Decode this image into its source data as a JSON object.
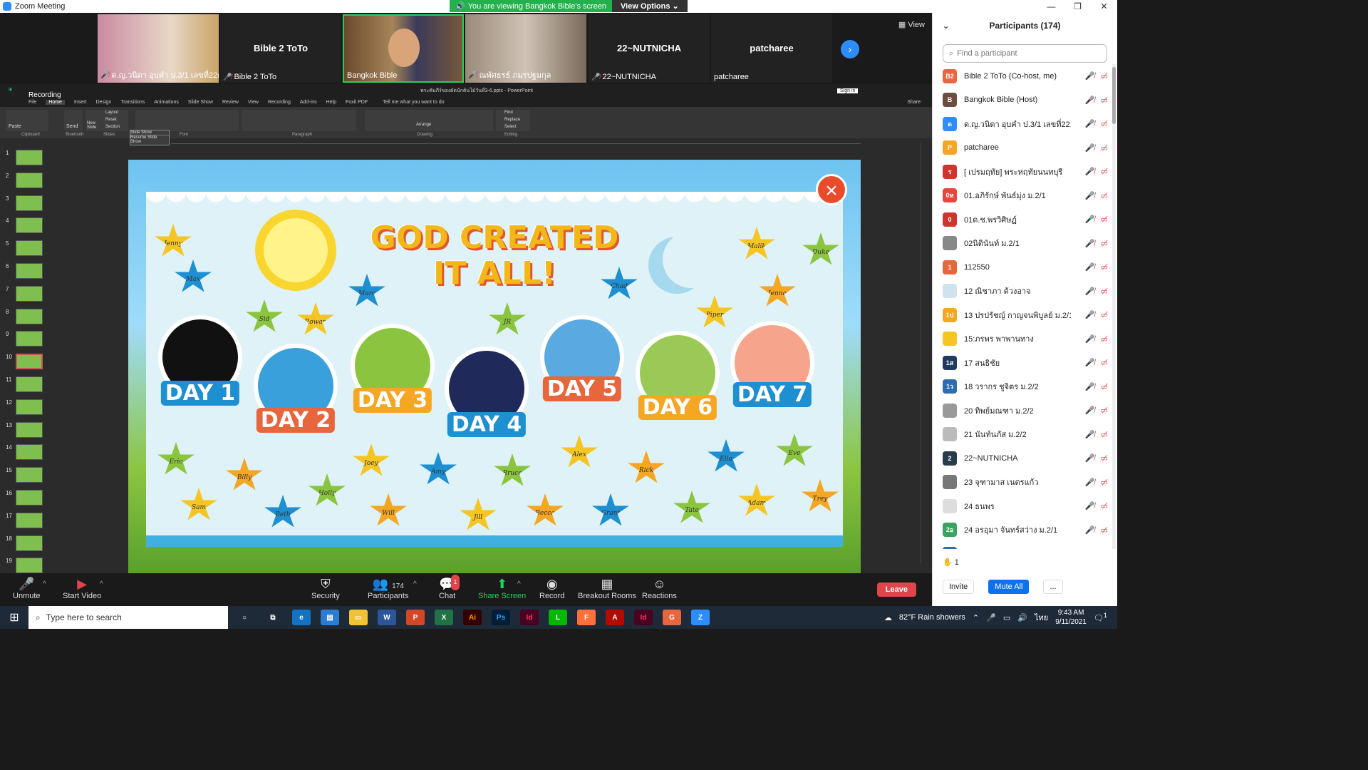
{
  "window": {
    "title": "Zoom Meeting"
  },
  "share_banner": {
    "text": "You are viewing Bangkok Bible's screen",
    "options_label": "View Options"
  },
  "video_strip": {
    "view_label": "View",
    "tiles": [
      {
        "name": "ด.ญ.วนิดา อุบคำ ป.3/1 เลขที่22(w...",
        "big": ""
      },
      {
        "name": "Bible 2 ToTo",
        "big": "Bible 2 ToTo"
      },
      {
        "name": "Bangkok Bible",
        "big": ""
      },
      {
        "name": "ณพัศธรธ์ ภมรปฐมกุล",
        "big": ""
      },
      {
        "name": "22~NUTNICHA",
        "big": "22~NUTNICHA"
      },
      {
        "name": "patcharee",
        "big": "patcharee"
      }
    ]
  },
  "powerpoint": {
    "title": "พระคัมภีร์ของผัดนักต้นไม้วันที่3-6.pptx - PowerPoint",
    "recording_label": "Recording",
    "signin": "Sign in",
    "share": "Share",
    "tell_me": "Tell me what you want to do",
    "tabs": [
      "File",
      "Home",
      "Insert",
      "Design",
      "Transitions",
      "Animations",
      "Slide Show",
      "Review",
      "View",
      "Recording",
      "Add-ins",
      "Help",
      "Foxit PDF"
    ],
    "ribbon_groups": [
      "Clipboard",
      "Bluetooth",
      "Slides",
      "Font",
      "Paragraph",
      "Drawing",
      "Editing"
    ],
    "ribbon_labels": {
      "paste": "Paste",
      "send": "Send",
      "new_slide": "New Slide",
      "layout": "Layout",
      "reset": "Reset",
      "section": "Section",
      "find": "Find",
      "replace": "Replace",
      "select": "Select",
      "arrange": "Arrange"
    },
    "slideshow_popup": {
      "title": "Slide Show",
      "resume": "Resume Slide Show"
    },
    "thumbnail_numbers": [
      "1",
      "2",
      "3",
      "4",
      "5",
      "6",
      "7",
      "8",
      "9",
      "10",
      "11",
      "12",
      "13",
      "14",
      "15",
      "16",
      "17",
      "18",
      "19"
    ],
    "selected_thumbnail": "10"
  },
  "slide": {
    "title_line1": "GOD CREATED",
    "title_line2": "IT ALL!",
    "days": [
      "DAY 1",
      "DAY 2",
      "DAY 3",
      "DAY 4",
      "DAY 5",
      "DAY 6",
      "DAY 7"
    ],
    "star_names": [
      "Jenny",
      "Max",
      "Sid",
      "Rowan",
      "Marc",
      "JR",
      "Chad",
      "Malik",
      "Duke",
      "Jenna",
      "Piper",
      "Eric",
      "Billy",
      "Holly",
      "Joey",
      "Amy",
      "Bruce",
      "Alex",
      "Rick",
      "Ella",
      "Eve",
      "Sam",
      "Beth",
      "Will",
      "Jill",
      "Becca",
      "Grant",
      "Tate",
      "Adam",
      "Trey"
    ]
  },
  "toolbar": {
    "unmute": "Unmute",
    "start_video": "Start Video",
    "security": "Security",
    "participants": "Participants",
    "participants_count": "174",
    "chat": "Chat",
    "chat_badge": "1",
    "share_screen": "Share Screen",
    "record": "Record",
    "breakout": "Breakout Rooms",
    "reactions": "Reactions",
    "leave": "Leave"
  },
  "participants_panel": {
    "title": "Participants (174)",
    "search_placeholder": "Find a participant",
    "raised_hands": "1",
    "invite": "Invite",
    "mute_all": "Mute All",
    "more": "...",
    "rows": [
      {
        "initials": "B2",
        "color": "#e8663d",
        "name": "Bible 2 ToTo (Co-host, me)"
      },
      {
        "initials": "B",
        "color": "#6d4c41",
        "name": "Bangkok Bible (Host)"
      },
      {
        "initials": "ด",
        "color": "#2d8cff",
        "name": "ด.ญ.วนิดา อุบคำ ป.3/1 เลขที่22..."
      },
      {
        "initials": "P",
        "color": "#f5a623",
        "name": "patcharee"
      },
      {
        "initials": "ร",
        "color": "#d0342c",
        "name": "[ เปรมฤทัย] พระหฤทัยนนทบุรี"
      },
      {
        "initials": "0ห",
        "color": "#e8463d",
        "name": "01.อภิรักษ์ พันธ์มุ่ง ม.2/1"
      },
      {
        "initials": "0",
        "color": "#d0342c",
        "name": "01ด.ช.พรวิศิษฏ์"
      },
      {
        "initials": "",
        "color": "#888888",
        "name": "02นิตินันท์ ม.2/1"
      },
      {
        "initials": "1",
        "color": "#e8663d",
        "name": "112550"
      },
      {
        "initials": "",
        "color": "#cfe3ee",
        "name": "12 ณิชาภา ด้วงอาจ"
      },
      {
        "initials": "1ป",
        "color": "#f5a623",
        "name": "13 ปรปรัชญ์ กาญจนพิบูลย์ ม.2/1"
      },
      {
        "initials": "",
        "color": "#f5c623",
        "name": "15:ภรพร พาพานทาง"
      },
      {
        "initials": "1ส",
        "color": "#1f3a5f",
        "name": "17 สนธิชัย"
      },
      {
        "initials": "1ว",
        "color": "#2d6cae",
        "name": "18 วรากร ชูจิตร ม.2/2"
      },
      {
        "initials": "",
        "color": "#999999",
        "name": "20 ทิพย์มณฑา ม.2/2"
      },
      {
        "initials": "",
        "color": "#bbbbbb",
        "name": "21 นันท์นภัส ม.2/2"
      },
      {
        "initials": "2",
        "color": "#2a3b4c",
        "name": "22~NUTNICHA"
      },
      {
        "initials": "",
        "color": "#777777",
        "name": "23 จุฑามาส เนตรแก้ว"
      },
      {
        "initials": "",
        "color": "#dddddd",
        "name": "24 ธนพร"
      },
      {
        "initials": "2อ",
        "color": "#3aa35f",
        "name": "24 อรอุมา จันทร์สว่าง ม.2/1"
      },
      {
        "initials": "",
        "color": "#2d6cae",
        "name": ""
      }
    ]
  },
  "taskbar": {
    "search_placeholder": "Type here to search",
    "weather": "82°F  Rain showers",
    "lang": "ไทย",
    "time": "9:43 AM",
    "date": "9/11/2021",
    "notifications": "1"
  }
}
